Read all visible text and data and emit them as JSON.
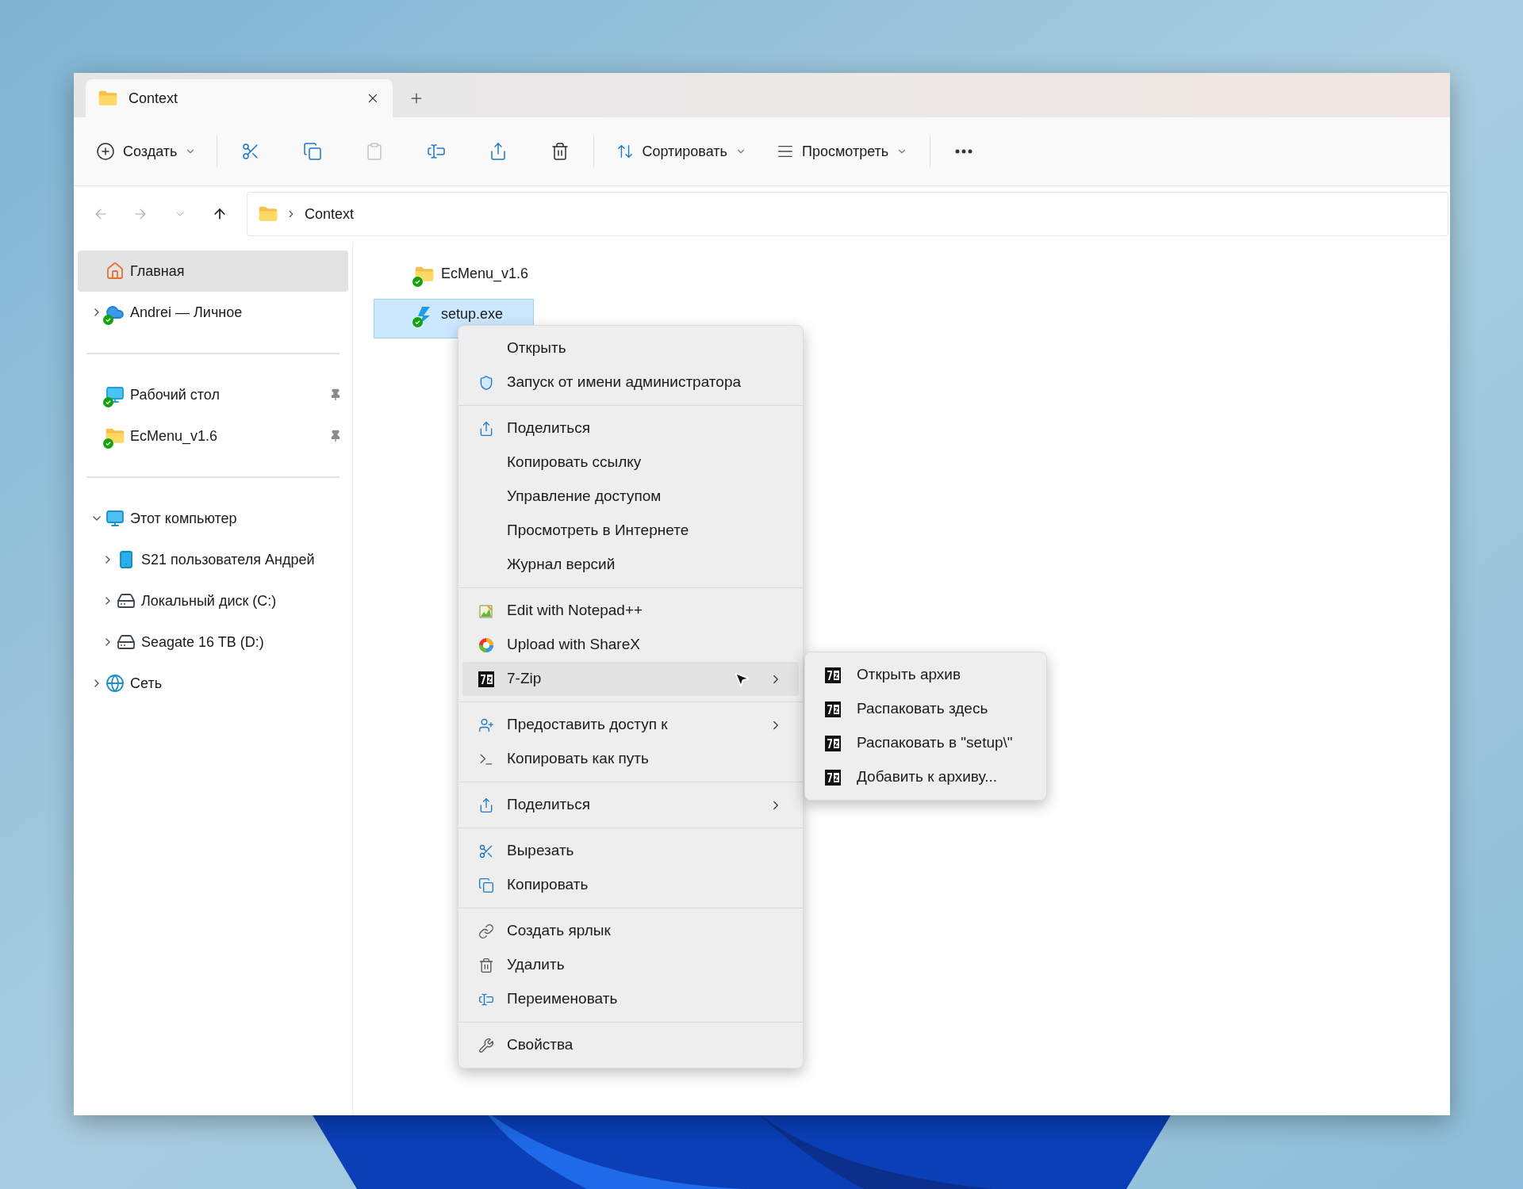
{
  "tab": {
    "title": "Context",
    "selected": true
  },
  "toolbar": {
    "new_label": "Создать",
    "actions": [
      {
        "kind": "cut",
        "disabled": false
      },
      {
        "kind": "copy",
        "disabled": false
      },
      {
        "kind": "paste",
        "disabled": true
      },
      {
        "kind": "rename",
        "disabled": false
      },
      {
        "kind": "share",
        "disabled": false
      },
      {
        "kind": "delete",
        "disabled": false
      }
    ],
    "sort_label": "Сортировать",
    "view_label": "Просмотреть"
  },
  "navigation": [
    {
      "kind": "back",
      "disabled": true
    },
    {
      "kind": "forward",
      "disabled": true
    },
    {
      "kind": "recent",
      "disabled": true
    },
    {
      "kind": "up",
      "disabled": false
    }
  ],
  "breadcrumb": [
    "Context"
  ],
  "sidebar": {
    "groups": [
      {
        "items": [
          {
            "label": "Главная",
            "kind": "home",
            "selected": true,
            "synced": false,
            "pinned": false
          },
          {
            "label": "Andrei — Личное",
            "kind": "cloud",
            "selected": false,
            "synced": true,
            "pinned": false,
            "expanded": false
          }
        ]
      },
      {
        "items": [
          {
            "label": "Рабочий стол",
            "kind": "desktop",
            "selected": false,
            "synced": true,
            "pinned": true
          },
          {
            "label": "EcMenu_v1.6",
            "kind": "folder",
            "selected": false,
            "synced": true,
            "pinned": true
          }
        ]
      },
      {
        "items": [
          {
            "label": "Этот компьютер",
            "kind": "pc",
            "selected": false,
            "synced": false,
            "pinned": false,
            "expanded": true,
            "children": [
              {
                "label": "S21 пользователя Андрей",
                "kind": "phone",
                "selected": false,
                "synced": false,
                "pinned": false,
                "expanded": false
              },
              {
                "label": "Локальный диск (C:)",
                "kind": "system-drive",
                "selected": false,
                "synced": false,
                "pinned": false,
                "expanded": false
              },
              {
                "label": "Seagate 16 TB (D:)",
                "kind": "drive",
                "selected": false,
                "synced": false,
                "pinned": false,
                "expanded": false
              }
            ]
          },
          {
            "label": "Сеть",
            "kind": "network",
            "selected": false,
            "synced": false,
            "pinned": false,
            "expanded": false
          }
        ]
      }
    ]
  },
  "files": [
    {
      "name": "EcMenu_v1.6",
      "kind": "folder",
      "synced": true,
      "selected": false
    },
    {
      "name": "setup.exe",
      "kind": "exe",
      "synced": true,
      "selected": true
    }
  ],
  "context_menu": {
    "sections": [
      {
        "items": [
          {
            "label": "Открыть",
            "kind": "open",
            "submenu": false,
            "selected": false
          },
          {
            "label": "Запуск от имени администратора",
            "kind": "admin",
            "submenu": false,
            "selected": false
          }
        ]
      },
      {
        "items": [
          {
            "label": "Поделиться",
            "kind": "share",
            "submenu": false,
            "selected": false
          },
          {
            "label": "Копировать ссылку",
            "kind": "plain",
            "submenu": false,
            "selected": false
          },
          {
            "label": "Управление доступом",
            "kind": "plain",
            "submenu": false,
            "selected": false
          },
          {
            "label": "Просмотреть в Интернете",
            "kind": "plain",
            "submenu": false,
            "selected": false
          },
          {
            "label": "Журнал версий",
            "kind": "plain",
            "submenu": false,
            "selected": false
          }
        ]
      },
      {
        "items": [
          {
            "label": "Edit with Notepad++",
            "kind": "notepad",
            "submenu": false,
            "selected": false
          },
          {
            "label": "Upload with ShareX",
            "kind": "sharex",
            "submenu": false,
            "selected": false
          },
          {
            "label": "7-Zip",
            "kind": "zip",
            "submenu": true,
            "selected": true
          }
        ]
      },
      {
        "items": [
          {
            "label": "Предоставить доступ к",
            "kind": "access",
            "submenu": true,
            "selected": false
          },
          {
            "label": "Копировать как путь",
            "kind": "path",
            "submenu": false,
            "selected": false
          }
        ]
      },
      {
        "items": [
          {
            "label": "Поделиться",
            "kind": "share",
            "submenu": true,
            "selected": false
          }
        ]
      },
      {
        "items": [
          {
            "label": "Вырезать",
            "kind": "cut",
            "submenu": false,
            "selected": false
          },
          {
            "label": "Копировать",
            "kind": "copy",
            "submenu": false,
            "selected": false
          }
        ]
      },
      {
        "items": [
          {
            "label": "Создать ярлык",
            "kind": "shortcut",
            "submenu": false,
            "selected": false
          },
          {
            "label": "Удалить",
            "kind": "delete",
            "submenu": false,
            "selected": false
          },
          {
            "label": "Переименовать",
            "kind": "rename",
            "submenu": false,
            "selected": false
          }
        ]
      },
      {
        "items": [
          {
            "label": "Свойства",
            "kind": "properties",
            "submenu": false,
            "selected": false
          }
        ]
      }
    ]
  },
  "submenu": {
    "items": [
      {
        "label": "Открыть архив",
        "kind": "zip"
      },
      {
        "label": "Распаковать здесь",
        "kind": "zip"
      },
      {
        "label": "Распаковать в \"setup\\\"",
        "kind": "zip"
      },
      {
        "label": "Добавить к архиву...",
        "kind": "zip"
      }
    ]
  }
}
